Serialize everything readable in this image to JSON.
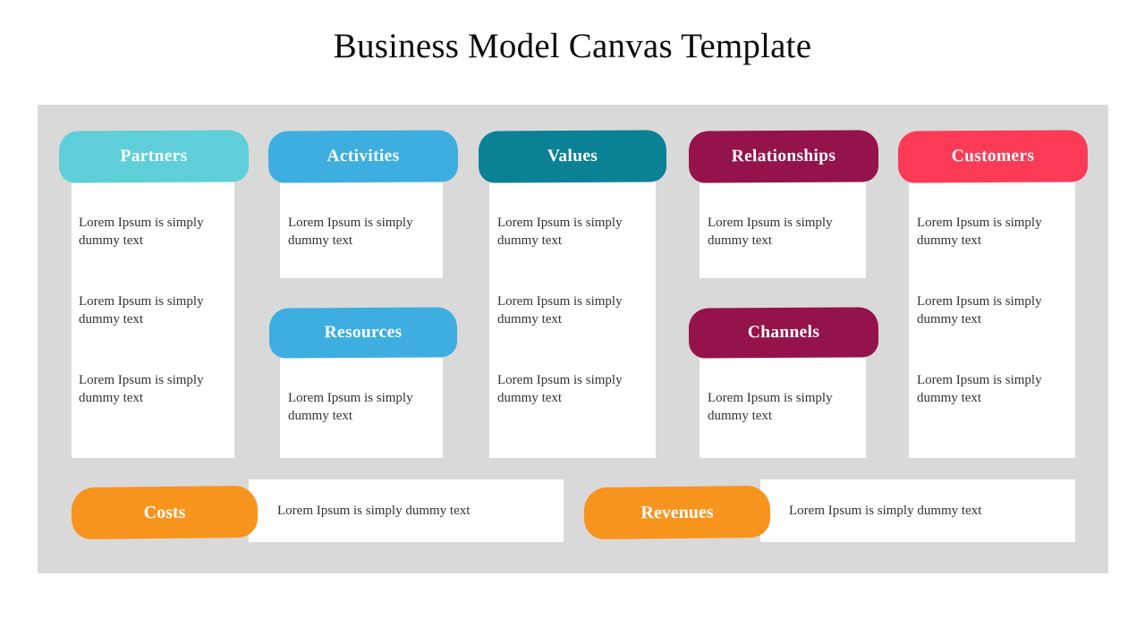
{
  "title": "Business Model Canvas Template",
  "colors": {
    "background": "#ffffff",
    "panel": "#d9d9d9",
    "card": "#ffffff",
    "title_text": "#0d0d0d",
    "body_text": "#333333",
    "partners": "#5ecfd8",
    "activities": "#3eaee0",
    "resources": "#3eaee0",
    "values": "#0a8195",
    "relationships": "#94134a",
    "channels": "#94134a",
    "customers": "#fb3b56",
    "costs": "#f7941e",
    "revenues": "#f7941e"
  },
  "columns": [
    {
      "id": "partners",
      "header": "Partners",
      "blocks": [
        {
          "header": null,
          "items": [
            "Lorem Ipsum is simply dummy text",
            "Lorem Ipsum is simply dummy text",
            "Lorem Ipsum is simply dummy text"
          ]
        }
      ]
    },
    {
      "id": "activities",
      "header": "Activities",
      "blocks": [
        {
          "header": "Activities",
          "items": [
            "Lorem Ipsum is simply dummy text"
          ]
        },
        {
          "header": "Resources",
          "items": [
            "Lorem Ipsum is simply dummy text"
          ]
        }
      ]
    },
    {
      "id": "values",
      "header": "Values",
      "blocks": [
        {
          "header": null,
          "items": [
            "Lorem Ipsum is simply dummy text",
            "Lorem Ipsum is simply dummy text",
            "Lorem Ipsum is simply dummy text"
          ]
        }
      ]
    },
    {
      "id": "relationships",
      "header": "Relationships",
      "blocks": [
        {
          "header": "Relationships",
          "items": [
            "Lorem Ipsum is simply dummy text"
          ]
        },
        {
          "header": "Channels",
          "items": [
            "Lorem Ipsum is simply dummy text"
          ]
        }
      ]
    },
    {
      "id": "customers",
      "header": "Customers",
      "blocks": [
        {
          "header": null,
          "items": [
            "Lorem Ipsum is simply dummy text",
            "Lorem Ipsum is simply dummy text",
            "Lorem Ipsum is simply dummy text"
          ]
        }
      ]
    }
  ],
  "headers": {
    "partners": "Partners",
    "activities": "Activities",
    "resources": "Resources",
    "values": "Values",
    "relationships": "Relationships",
    "channels": "Channels",
    "customers": "Customers",
    "costs": "Costs",
    "revenues": "Revenues"
  },
  "body": {
    "lorem": "Lorem Ipsum is simply dummy text",
    "col1_item1": "Lorem Ipsum is simply dummy text",
    "col1_item2": "Lorem Ipsum is simply dummy text",
    "col1_item3": "Lorem Ipsum is simply dummy text",
    "col2_item1": "Lorem Ipsum is simply dummy text",
    "col2_item2": "Lorem Ipsum is simply dummy text",
    "col3_item1": "Lorem Ipsum is simply dummy text",
    "col3_item2": "Lorem Ipsum is simply dummy text",
    "col3_item3": "Lorem Ipsum is simply dummy text",
    "col4_item1": "Lorem Ipsum is simply dummy text",
    "col4_item2": "Lorem Ipsum is simply dummy text",
    "col5_item1": "Lorem Ipsum is simply dummy text",
    "col5_item2": "Lorem Ipsum is simply dummy text",
    "col5_item3": "Lorem Ipsum is simply dummy text",
    "costs_text": "Lorem Ipsum is simply dummy text",
    "revenues_text": "Lorem Ipsum is simply dummy text"
  }
}
